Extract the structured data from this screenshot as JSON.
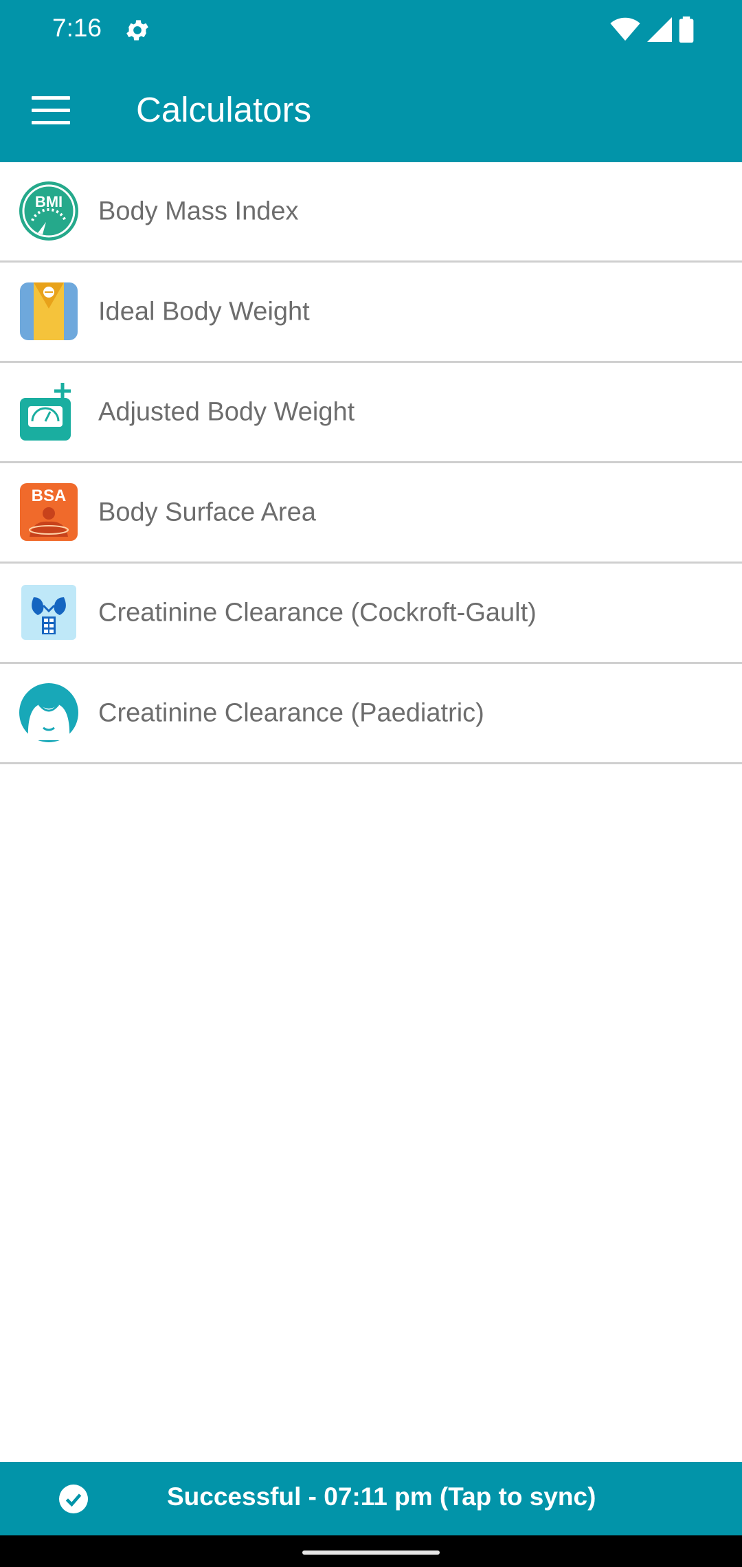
{
  "status_bar": {
    "time": "7:16",
    "icons": [
      "gear-icon",
      "wifi-icon",
      "cell-signal-icon",
      "battery-icon"
    ]
  },
  "app_bar": {
    "title": "Calculators",
    "menu_icon": "hamburger-menu-icon"
  },
  "calculators": [
    {
      "label": "Body Mass Index",
      "icon": "bmi-icon",
      "icon_text": "BMI"
    },
    {
      "label": "Ideal Body Weight",
      "icon": "ideal-body-weight-icon"
    },
    {
      "label": "Adjusted Body Weight",
      "icon": "adjusted-body-weight-icon"
    },
    {
      "label": "Body Surface Area",
      "icon": "bsa-icon",
      "icon_text": "BSA"
    },
    {
      "label": "Creatinine Clearance (Cockroft-Gault)",
      "icon": "kidney-calculator-icon"
    },
    {
      "label": "Creatinine Clearance (Paediatric)",
      "icon": "paediatric-icon"
    }
  ],
  "sync": {
    "text": "Successful - 07:11 pm (Tap to sync)",
    "icon": "check-circle-icon"
  },
  "colors": {
    "primary": "#0294a9",
    "text": "#6d6d6d",
    "divider": "#cfcfcf"
  }
}
